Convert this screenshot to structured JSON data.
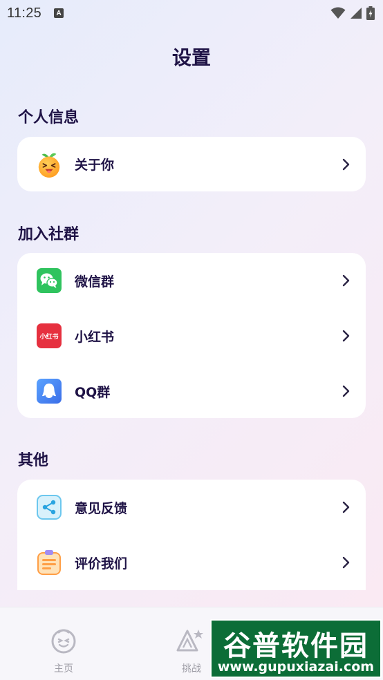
{
  "status_bar": {
    "time": "11:25",
    "notification_badge": "A"
  },
  "page_title": "设置",
  "sections": {
    "personal": {
      "title": "个人信息",
      "items": [
        {
          "label": "关于你",
          "icon": "orange-mascot-icon"
        }
      ]
    },
    "community": {
      "title": "加入社群",
      "items": [
        {
          "label": "微信群",
          "icon": "wechat-icon"
        },
        {
          "label": "小红书",
          "icon": "xiaohongshu-icon",
          "icon_text": "小红书"
        },
        {
          "label": "QQ群",
          "icon": "qq-icon"
        }
      ]
    },
    "other": {
      "title": "其他",
      "items": [
        {
          "label": "意见反馈",
          "icon": "share-feedback-icon"
        },
        {
          "label": "评价我们",
          "icon": "clipboard-icon"
        }
      ]
    }
  },
  "tabbar": {
    "tabs": [
      {
        "label": "主页",
        "icon": "home-smiley-icon"
      },
      {
        "label": "挑战",
        "icon": "challenge-triangle-icon"
      }
    ]
  },
  "watermark": {
    "chinese": "谷普软件园",
    "url": "www.gupuxiazai.com"
  },
  "colors": {
    "title_text": "#1f1346",
    "wechat_green": "#2fc35e",
    "xiaohongshu_red": "#e6303f",
    "qq_blue": "#4a8bf0",
    "watermark_green": "#0c6d37"
  }
}
